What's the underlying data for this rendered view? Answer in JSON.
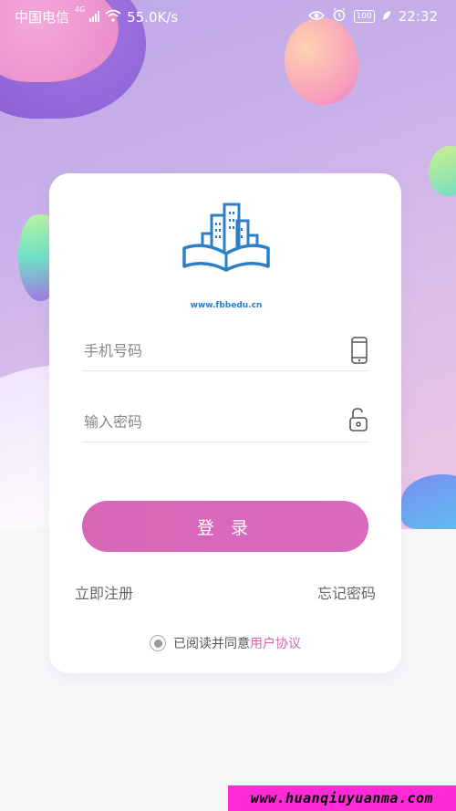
{
  "status_bar": {
    "carrier": "中国电信",
    "network": "4G",
    "speed": "55.0K/s",
    "battery": "100",
    "time": "22:32"
  },
  "brand": {
    "logo_icon": "book-city-icon",
    "url": "www.fbbedu.cn",
    "color": "#2a7fc7"
  },
  "form": {
    "phone_placeholder": "手机号码",
    "phone_icon": "mobile-phone-icon",
    "password_placeholder": "输入密码",
    "password_icon": "unlock-icon",
    "login_label": "登 录",
    "register_label": "立即注册",
    "forgot_label": "忘记密码",
    "agreement_prefix": "已阅读并同意",
    "agreement_link": "用户协议"
  },
  "colors": {
    "accent": "#d866b7"
  },
  "watermark": "www.huanqiuyuanma.com"
}
